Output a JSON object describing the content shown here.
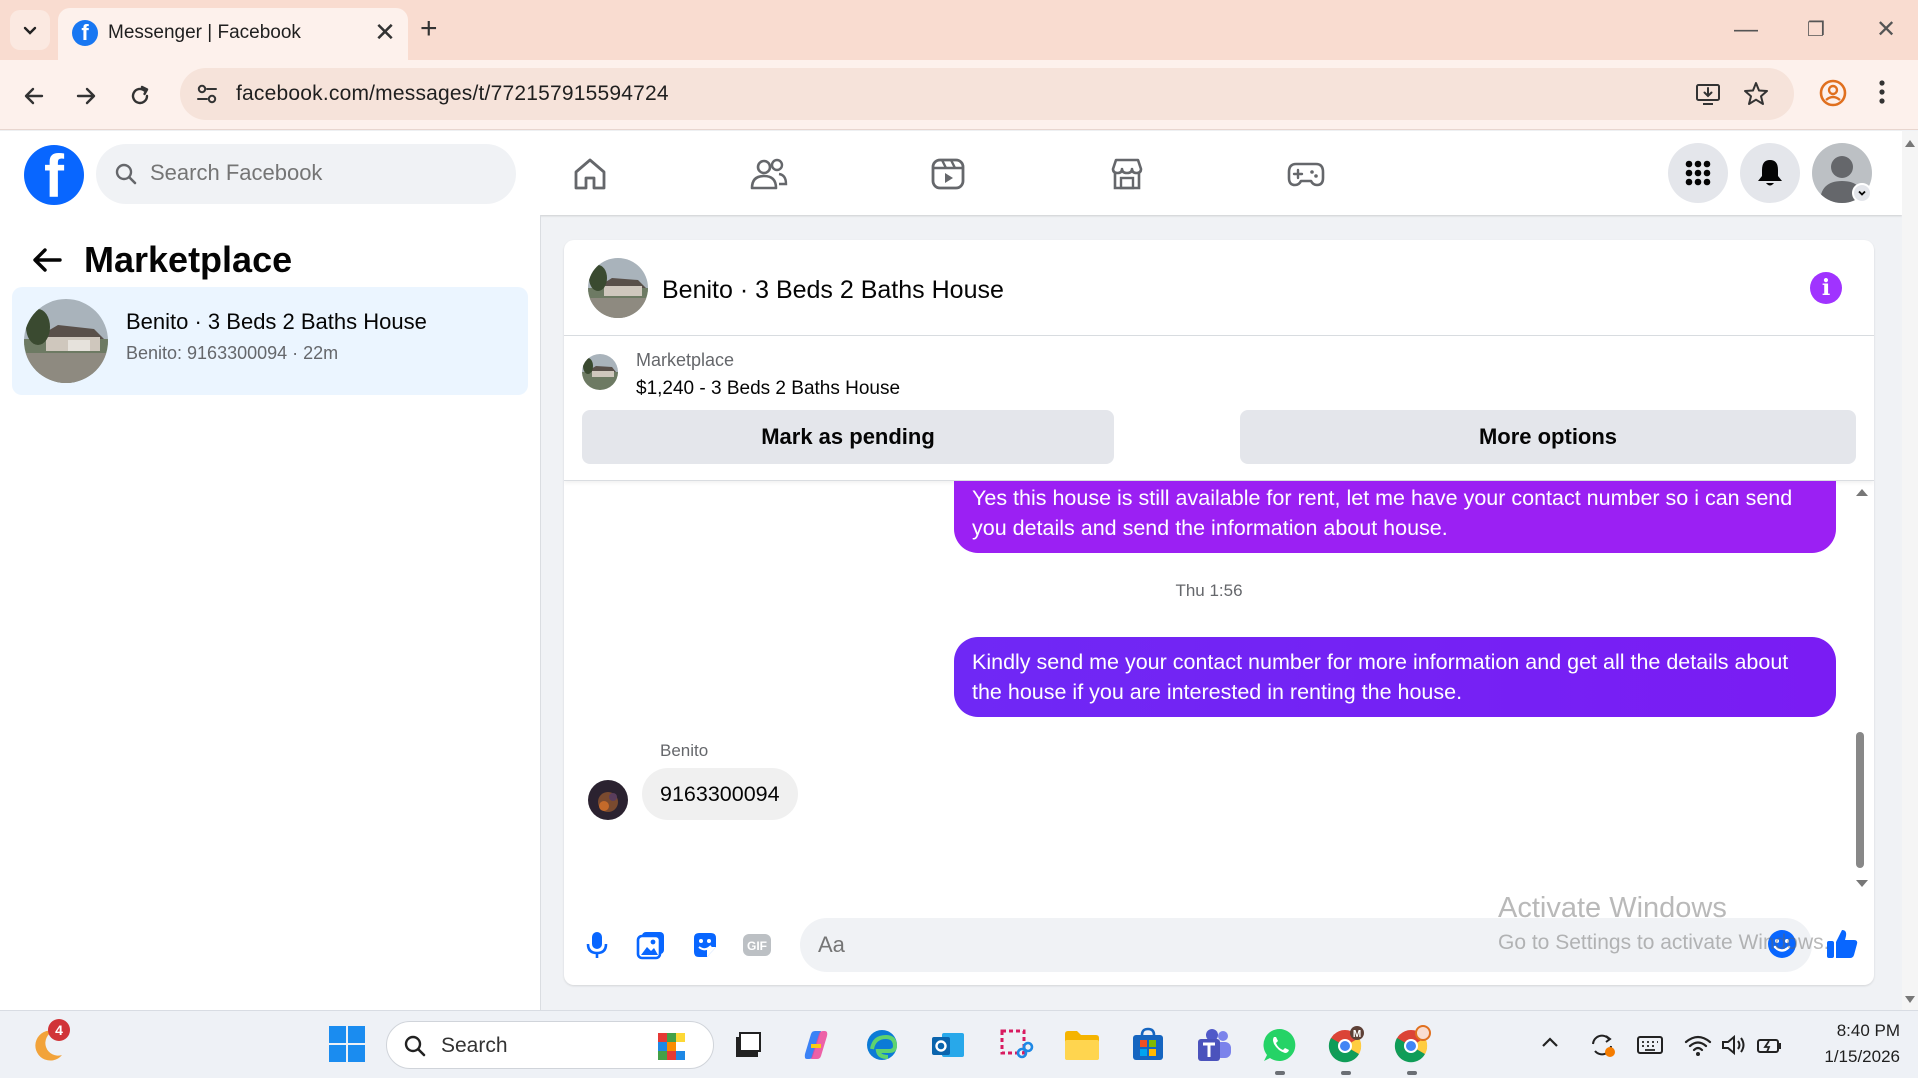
{
  "browser": {
    "tab_title": "Messenger | Facebook",
    "favicon_letter": "f",
    "new_tab_label": "+",
    "tab_close_label": "✕",
    "url": "facebook.com/messages/t/772157915594724",
    "window_controls": {
      "minimize": "—",
      "restore": "❐",
      "close": "✕"
    }
  },
  "fb": {
    "logo_letter": "f",
    "search_placeholder": "Search Facebook",
    "nav_icons": [
      "home-icon",
      "friends-icon",
      "video-icon",
      "marketplace-icon",
      "gaming-icon"
    ]
  },
  "left_panel": {
    "heading": "Marketplace",
    "conversation": {
      "title": "Benito · 3 Beds 2 Baths House",
      "snippet": "Benito: 9163300094 · 22m"
    }
  },
  "chat": {
    "title": "Benito · 3 Beds 2 Baths House",
    "info_label": "i",
    "listing": {
      "source": "Marketplace",
      "price_title": "$1,240 - 3 Beds 2 Baths House",
      "buttons": {
        "pending": "Mark as pending",
        "more": "More options"
      }
    },
    "messages": {
      "outgoing_1": "Yes this house is still available for rent, let me have your contact number so i can send you details and send the information about house.",
      "timestamp": "Thu 1:56",
      "outgoing_2": "Kindly send me your contact number for more information and get all the details about the house if you are interested in renting the house.",
      "sender": "Benito",
      "incoming_1": "9163300094"
    },
    "composer_placeholder": "Aa"
  },
  "watermark": {
    "title": "Activate Windows",
    "subtitle": "Go to Settings to activate Windows."
  },
  "taskbar": {
    "weather_badge": "4",
    "search_label": "Search",
    "clock_time": "8:40 PM",
    "clock_date": "1/15/2026"
  },
  "colors": {
    "fb_blue": "#0866ff",
    "outgoing_bubble": "#9b20f3",
    "outgoing_bubble_2": "#7a1cf3",
    "selected_conversation": "#ebf5ff",
    "chrome_tabstrip": "#f9dcd0"
  }
}
